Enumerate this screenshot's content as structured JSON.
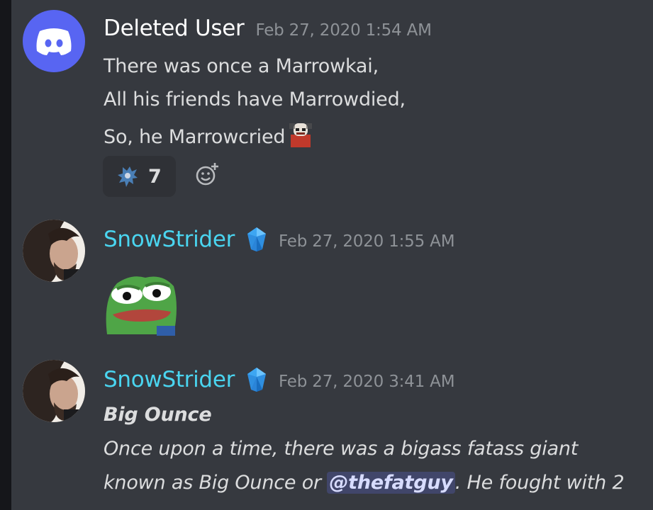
{
  "messages": [
    {
      "author": "Deleted User",
      "timestamp": "Feb 27, 2020 1:54 AM",
      "avatar_icon": "discord-logo-icon",
      "lines": [
        "There was once a Marrowkai,",
        "All his friends have Marrowdied,",
        "So, he Marrowcried"
      ],
      "inline_emoji": "marrowkai-emoji",
      "reaction": {
        "emoji": "marrowkai-reaction-emoji",
        "count": "7"
      },
      "add_reaction_icon": "add-reaction-icon"
    },
    {
      "author": "SnowStrider",
      "timestamp": "Feb 27, 2020 1:55 AM",
      "badge_icon": "blue-gem-icon",
      "content_emoji": "pepe-frog-emoji"
    },
    {
      "author": "SnowStrider",
      "timestamp": "Feb 27, 2020 3:41 AM",
      "badge_icon": "blue-gem-icon",
      "title": "Big Ounce",
      "line1": "Once upon a time, there was a bigass fatass giant",
      "line2_pre": "known as Big Ounce or ",
      "mention": "@thefatguy",
      "line2_post": ". He fought with 2"
    }
  ],
  "colors": {
    "background": "#36393f",
    "username_default": "#ffffff",
    "username_role": "#4ad5f0",
    "timestamp": "#8e9297",
    "mention_bg": "#41466a",
    "discord_blurple": "#5865f2"
  }
}
